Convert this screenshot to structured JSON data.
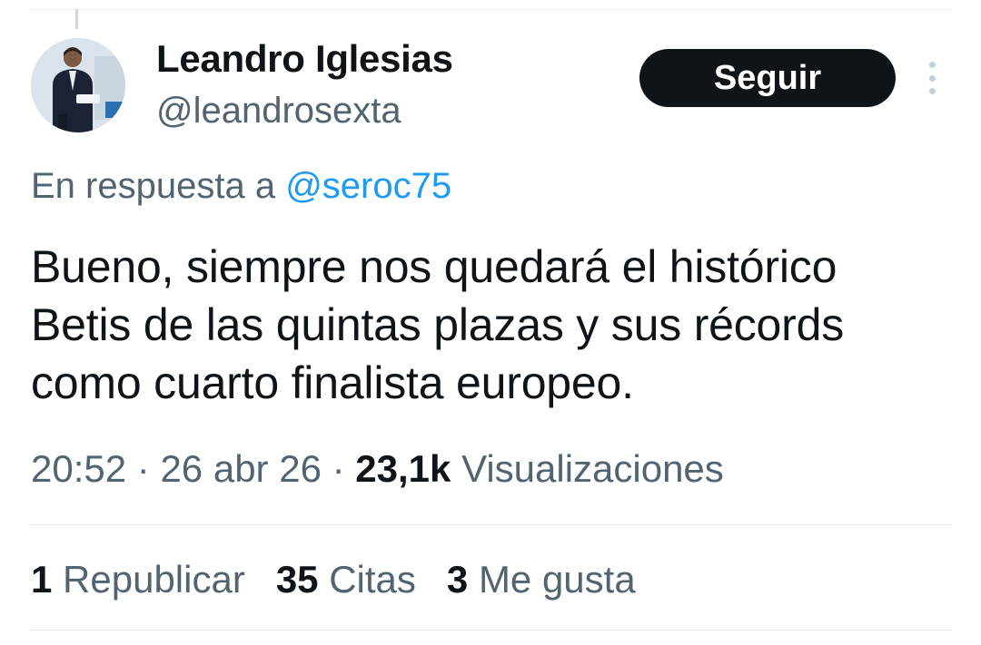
{
  "tweet": {
    "author_name": "Leandro Iglesias",
    "author_handle": "@leandrosexta",
    "follow_label": "Seguir",
    "reply_prefix": "En respuesta a ",
    "reply_mention": "@seroc75",
    "text": "Bueno, siempre nos quedará el histórico\nBetis de las quintas plazas y sus récords\ncomo cuarto finalista europeo.",
    "time": "20:52",
    "separator": "·",
    "date": "26 abr 26",
    "views_count": "23,1k",
    "views_label": "Visualizaciones"
  },
  "stats": [
    {
      "count": "1",
      "label": "Republicar"
    },
    {
      "count": "35",
      "label": "Citas"
    },
    {
      "count": "3",
      "label": "Me gusta"
    }
  ],
  "colors": {
    "text": "#0f1419",
    "secondary": "#536471",
    "link": "#1d9bf0",
    "button_bg": "#0f1419",
    "button_text": "#ffffff"
  }
}
